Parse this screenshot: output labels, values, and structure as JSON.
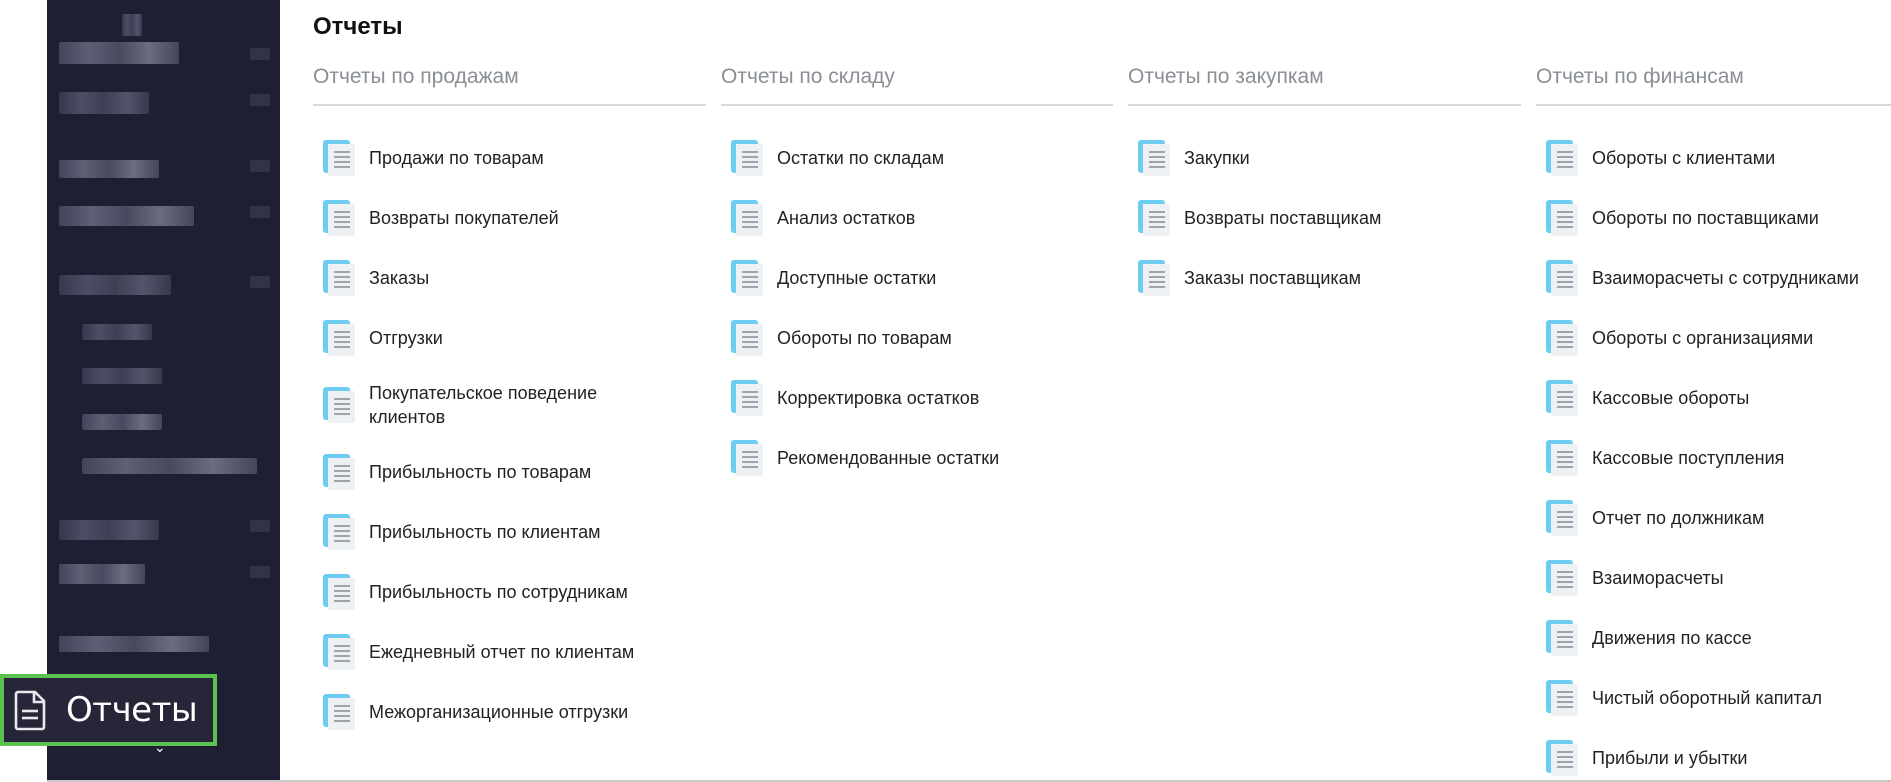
{
  "sidebar": {
    "active_item": {
      "label": "Отчеты",
      "icon": "document-icon"
    },
    "highlight_color": "#5bc24f",
    "background": "#1f1f33"
  },
  "main": {
    "title": "Отчеты",
    "columns": [
      {
        "header": "Отчеты по продажам",
        "items": [
          "Продажи по товарам",
          "Возвраты покупателей",
          "Заказы",
          "Отгрузки",
          "Покупательское поведение клиентов",
          "Прибыльность по товарам",
          "Прибыльность по клиентам",
          "Прибыльность по сотрудникам",
          "Ежедневный отчет по клиентам",
          "Межорганизационные отгрузки"
        ]
      },
      {
        "header": "Отчеты по складу",
        "items": [
          "Остатки по складам",
          "Анализ остатков",
          "Доступные остатки",
          "Обороты по товарам",
          "Корректировка остатков",
          "Рекомендованные остатки"
        ]
      },
      {
        "header": "Отчеты по закупкам",
        "items": [
          "Закупки",
          "Возвраты поставщикам",
          "Заказы поставщикам"
        ]
      },
      {
        "header": "Отчеты по финансам",
        "items": [
          "Обороты с клиентами",
          "Обороты по поставщиками",
          "Взаиморасчеты с сотрудниками",
          "Обороты с организациями",
          "Кассовые обороты",
          "Кассовые поступления",
          "Отчет по должникам",
          "Взаиморасчеты",
          "Движения по кассе",
          "Чистый оборотный капитал",
          "Прибыли и убытки"
        ]
      }
    ]
  },
  "icon_colors": {
    "doc_accent": "#6dcdf0",
    "doc_body": "#eef1f4",
    "doc_lines": "#8b9199"
  }
}
